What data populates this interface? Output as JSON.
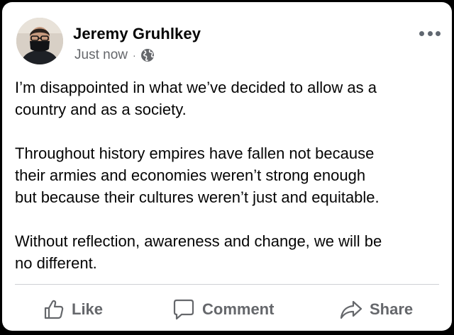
{
  "post": {
    "author": "Jeremy Gruhlkey",
    "timestamp": "Just now",
    "separator": "·",
    "audience_icon": "globe-icon",
    "menu_icon": "more-options-icon",
    "paragraphs": [
      {
        "lines": [
          "I’m disappointed in what we’ve decided to allow as a",
          "country and as a society."
        ]
      },
      {
        "lines": [
          "Throughout history empires have fallen not because",
          "their armies and economies weren’t strong enough",
          "but because their cultures weren’t just and equitable."
        ]
      },
      {
        "lines": [
          "Without reflection, awareness and change, we will be",
          "no different."
        ]
      }
    ]
  },
  "actions": {
    "like_label": "Like",
    "comment_label": "Comment",
    "share_label": "Share",
    "like_icon": "thumbs-up-icon",
    "comment_icon": "comment-bubble-icon",
    "share_icon": "share-arrow-icon"
  },
  "colors": {
    "text_primary": "#050505",
    "text_secondary": "#65676b",
    "card_background": "#ffffff",
    "outer_background": "#000000",
    "divider": "#ced0d4"
  }
}
